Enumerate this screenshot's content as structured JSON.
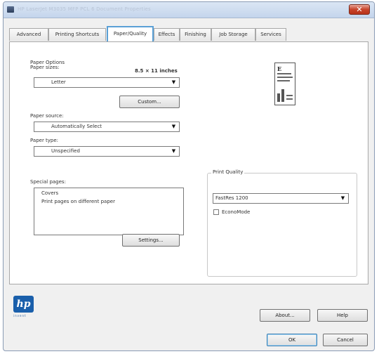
{
  "window": {
    "title": "HP LaserJet M3035 MFP PCL 6 Document Properties",
    "close_glyph": "✕"
  },
  "tabs": [
    {
      "label": "Advanced"
    },
    {
      "label": "Printing Shortcuts"
    },
    {
      "label": "Paper/Quality",
      "active": true
    },
    {
      "label": "Effects"
    },
    {
      "label": "Finishing"
    },
    {
      "label": "Job Storage"
    },
    {
      "label": "Services"
    }
  ],
  "paper_options": {
    "group_label": "Paper Options",
    "paper_sizes_label": "Paper sizes:",
    "paper_size_dimensions": "8.5 × 11 inches",
    "paper_size_value": "Letter",
    "custom_button": "Custom...",
    "paper_source_label": "Paper source:",
    "paper_source_value": "Automatically Select",
    "paper_type_label": "Paper type:",
    "paper_type_value": "Unspecified"
  },
  "special_pages": {
    "label": "Special pages:",
    "items": [
      "Covers",
      "Print pages on different paper"
    ],
    "settings_button": "Settings..."
  },
  "print_quality": {
    "group_label": "Print Quality",
    "value": "FastRes 1200",
    "economode_label": "EconoMode",
    "economode_checked": false
  },
  "preview": {
    "letter": "E"
  },
  "footer": {
    "logo_text": "hp",
    "logo_subtext": "invent",
    "about_button": "About...",
    "help_button": "Help",
    "ok_button": "OK",
    "cancel_button": "Cancel"
  },
  "icons": {
    "dropdown": "▼",
    "app": "printer-icon"
  }
}
